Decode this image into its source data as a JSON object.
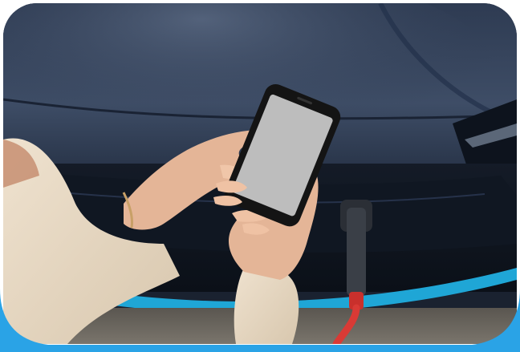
{
  "image": {
    "scene": "person-holding-phone-at-charging-electric-car",
    "accent_color": "#2aa3e6",
    "car_color": "#1c2a40",
    "phone_screen_color": "#bdbdbd",
    "cable_color": "#d93a35"
  }
}
